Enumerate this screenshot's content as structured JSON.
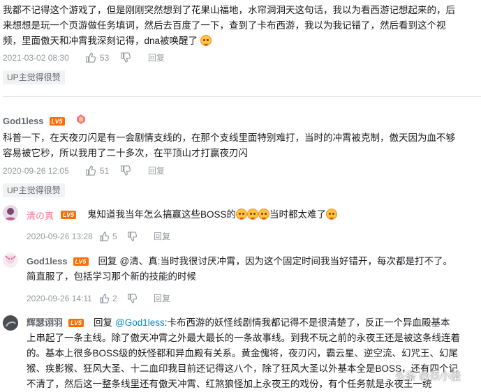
{
  "comments": [
    {
      "text": "我都不记得这个游戏了，但是刚刚突然想到了花果山福地，水帘洞洞天这句话，我以为看西游记想起来的，后来想想是玩一个页游做任务填词，然后去百度了一下，查到了卡布西游，我以为我记错了，然后看到这个视频，里面傲天和冲霄我深刻记得，dna被唤醒了",
      "line1": "我都不记得这个游戏了，但是刚刚突然想到了花果山福地，水帘洞洞天这句话，我以为看西游记想起来的，后",
      "line2": "来想想是玩一个页游做任务填词，然后去百度了一下，查到了卡布西游，我以为我记错了，然后看到这个视",
      "line3": "频，里面傲天和冲霄我深刻记得，dna被唤醒了",
      "time": "2021-03-02 08:30",
      "likes": "53",
      "reply_label": "回复",
      "tag": "UP主觉得很赞"
    },
    {
      "username": "God1less",
      "level": "LV5",
      "line1": "科普一下，在天夜刃闪是有一会剧情支线的，在那个支线里面特别难打，当时的冲霄被克制，傲天因为血不够",
      "line2": "容易被它秒，所以我用了二十多次，在平顶山才打赢夜刃闪",
      "time": "2020-09-26 12:05",
      "likes": "51",
      "reply_label": "回复",
      "tag": "UP主觉得很赞"
    },
    {
      "username": "清の真",
      "level": "LV5",
      "text_a": "鬼知道我当年怎么搞赢这些BOSS的",
      "text_b": "当时都太难了",
      "time": "2020-09-26 13:28",
      "likes": "5",
      "reply_label": "回复"
    },
    {
      "username": "God1less",
      "level": "LV5",
      "reply_prefix": "回复",
      "mention": "@清、真",
      "line1": ":当时我很讨厌冲霄，因为这个固定时间我当好错开，每次都是打不了。",
      "line2": "简直服了，包括学习那个新的技能的时候",
      "time": "2020-09-26 14:11",
      "likes": "2",
      "reply_label": "回复"
    },
    {
      "username": "辉瑟诩羽",
      "level": "LV5",
      "reply_prefix": "回复",
      "mention": "@God1less",
      "line1": ":卡布西游的妖怪线剧情我都记得不是很清楚了，反正一个异血殿基本",
      "line2": "上串起了一条主线。除了傲天冲霄之外最大最长的一条故事线。到我不玩之前的永夜王还是被这条线连着",
      "line3": "的。基本上很多BOSS级的妖怪都和异血殿有关系。黄金傀将，夜刃闪，霸云星、逆空流、幻咒王、幻尾",
      "line4": "猴、疾影猴、狂风大圣、十二血印我目前还记得这八个，除了狂风大圣以外基本全是BOSS，还有四个记",
      "line5": "不清了，然后这一整条线里还有傲天冲霄、红煞狼怪加上永夜王的戏份，有个任务就是永夜王一统"
    }
  ],
  "watermark": "头条 @采小羞",
  "colors": {
    "accent_pink": "#fb7299",
    "mention_blue": "#008ac5",
    "level_badge": "#ff6c00",
    "meta_gray": "#9499a0"
  }
}
